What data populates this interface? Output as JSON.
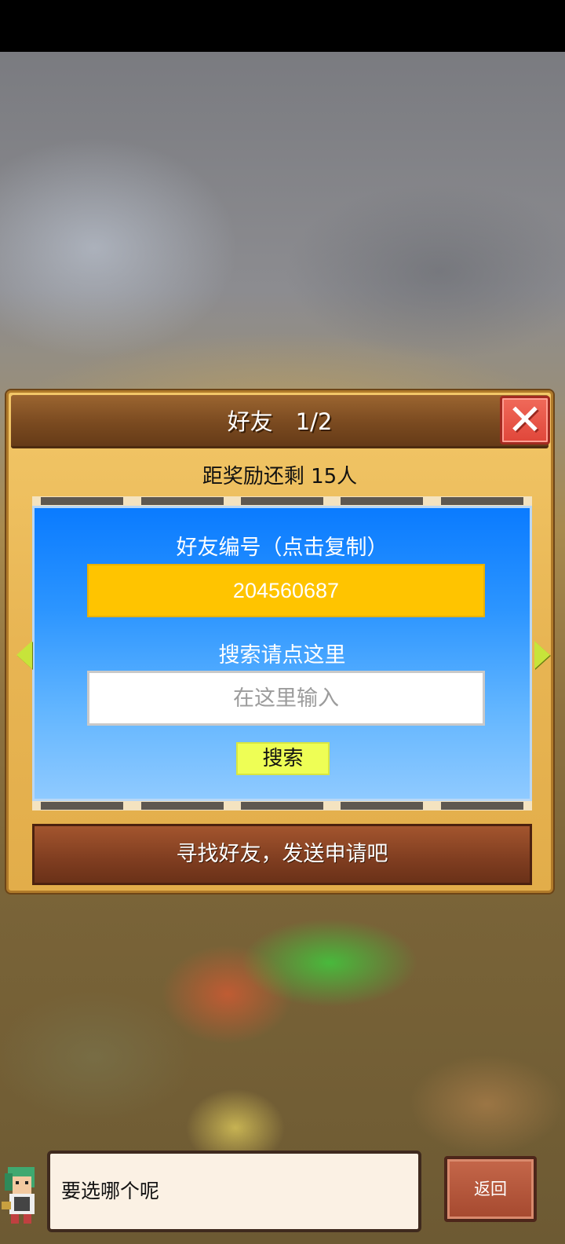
{
  "dialog": {
    "title": "好友　1/2",
    "close_icon": "close-x-icon",
    "reward_text": "距奖励还剩 15人",
    "friend_code_label": "好友编号（点击复制）",
    "friend_code": "204560687",
    "search_label": "搜索请点这里",
    "search_placeholder": "在这里输入",
    "search_button": "搜索",
    "find_friends": "寻找好友，发送申请吧"
  },
  "footer": {
    "bubble_text": "要选哪个呢",
    "back_button": "返回",
    "avatar_icon": "character-portrait-icon"
  },
  "colors": {
    "friend_code_bg": "#ffc400",
    "search_button_bg": "#eefe55",
    "close_button": "#e0463a",
    "panel_blue": "#0a7bff"
  }
}
